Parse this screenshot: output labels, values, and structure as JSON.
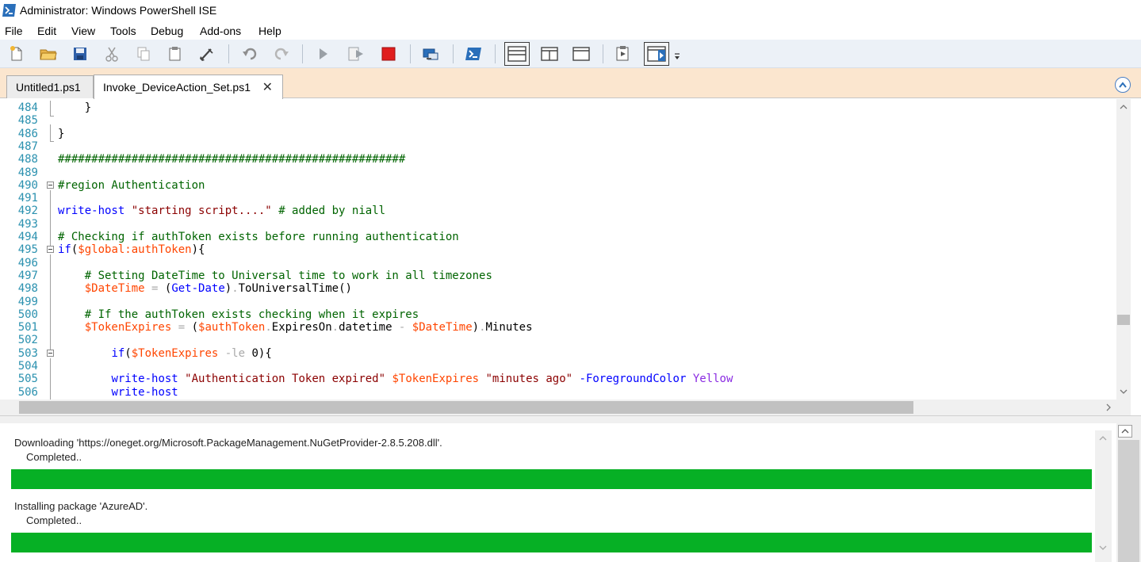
{
  "window": {
    "title": "Administrator: Windows PowerShell ISE"
  },
  "menu": {
    "items": [
      "File",
      "Edit",
      "View",
      "Tools",
      "Debug",
      "Add-ons",
      "Help"
    ]
  },
  "toolbar": {
    "buttons": [
      "new-file-icon",
      "open-folder-icon",
      "save-icon",
      "cut-icon",
      "copy-icon",
      "paste-icon",
      "clear-icon",
      "undo-icon",
      "redo-icon",
      "run-script-icon",
      "run-selection-icon",
      "stop-icon",
      "new-remote-tab-icon",
      "start-powershell-icon",
      "show-script-top-icon",
      "show-script-right-icon",
      "show-script-maximized-icon",
      "show-command-window-icon",
      "show-command-addon-icon",
      "toolbar-overflow-icon"
    ]
  },
  "tabs": [
    {
      "label": "Untitled1.ps1",
      "active": false
    },
    {
      "label": "Invoke_DeviceAction_Set.ps1",
      "active": true,
      "close_glyph": "✕"
    }
  ],
  "editor": {
    "lines": [
      {
        "n": "484",
        "tokens": [
          [
            "    }",
            "plain"
          ]
        ]
      },
      {
        "n": "485",
        "tokens": []
      },
      {
        "n": "486",
        "tokens": [
          [
            "}",
            "plain"
          ]
        ]
      },
      {
        "n": "487",
        "tokens": []
      },
      {
        "n": "488",
        "tokens": [
          [
            "####################################################",
            "comment"
          ]
        ]
      },
      {
        "n": "489",
        "tokens": []
      },
      {
        "n": "490",
        "tokens": [
          [
            "#region Authentication",
            "comment"
          ]
        ]
      },
      {
        "n": "491",
        "tokens": []
      },
      {
        "n": "492",
        "tokens": [
          [
            "write-host",
            "cmd"
          ],
          [
            " ",
            "plain"
          ],
          [
            "\"starting script....\"",
            "str"
          ],
          [
            " ",
            "plain"
          ],
          [
            "# added by niall",
            "comment"
          ]
        ]
      },
      {
        "n": "493",
        "tokens": []
      },
      {
        "n": "494",
        "tokens": [
          [
            "# Checking if authToken exists before running authentication",
            "comment"
          ]
        ]
      },
      {
        "n": "495",
        "tokens": [
          [
            "if",
            "cmd"
          ],
          [
            "(",
            "plain"
          ],
          [
            "$global:authToken",
            "var"
          ],
          [
            "){",
            "plain"
          ]
        ]
      },
      {
        "n": "496",
        "tokens": []
      },
      {
        "n": "497",
        "tokens": [
          [
            "    # Setting DateTime to Universal time to work in all timezones",
            "comment"
          ]
        ]
      },
      {
        "n": "498",
        "tokens": [
          [
            "    ",
            "plain"
          ],
          [
            "$DateTime",
            "var"
          ],
          [
            " = ",
            "op"
          ],
          [
            "(",
            "plain"
          ],
          [
            "Get-Date",
            "cmd"
          ],
          [
            ")",
            "plain"
          ],
          [
            ".",
            "op"
          ],
          [
            "ToUniversalTime",
            "member"
          ],
          [
            "()",
            "plain"
          ]
        ]
      },
      {
        "n": "499",
        "tokens": []
      },
      {
        "n": "500",
        "tokens": [
          [
            "    # If the authToken exists checking when it expires",
            "comment"
          ]
        ]
      },
      {
        "n": "501",
        "tokens": [
          [
            "    ",
            "plain"
          ],
          [
            "$TokenExpires",
            "var"
          ],
          [
            " = ",
            "op"
          ],
          [
            "(",
            "plain"
          ],
          [
            "$authToken",
            "var"
          ],
          [
            ".",
            "op"
          ],
          [
            "ExpiresOn",
            "member"
          ],
          [
            ".",
            "op"
          ],
          [
            "datetime",
            "member"
          ],
          [
            " - ",
            "op"
          ],
          [
            "$DateTime",
            "var"
          ],
          [
            ")",
            "plain"
          ],
          [
            ".",
            "op"
          ],
          [
            "Minutes",
            "member"
          ]
        ]
      },
      {
        "n": "502",
        "tokens": []
      },
      {
        "n": "503",
        "tokens": [
          [
            "        ",
            "plain"
          ],
          [
            "if",
            "cmd"
          ],
          [
            "(",
            "plain"
          ],
          [
            "$TokenExpires",
            "var"
          ],
          [
            " -le ",
            "op"
          ],
          [
            "0",
            "member"
          ],
          [
            "){",
            "plain"
          ]
        ]
      },
      {
        "n": "504",
        "tokens": []
      },
      {
        "n": "505",
        "tokens": [
          [
            "        ",
            "plain"
          ],
          [
            "write-host",
            "cmd"
          ],
          [
            " ",
            "plain"
          ],
          [
            "\"Authentication Token expired\"",
            "str"
          ],
          [
            " ",
            "plain"
          ],
          [
            "$TokenExpires",
            "var"
          ],
          [
            " ",
            "plain"
          ],
          [
            "\"minutes ago\"",
            "str"
          ],
          [
            " ",
            "plain"
          ],
          [
            "-ForegroundColor",
            "cmd"
          ],
          [
            " ",
            "plain"
          ],
          [
            "Yellow",
            "type"
          ]
        ]
      },
      {
        "n": "506",
        "tokens": [
          [
            "        ",
            "plain"
          ],
          [
            "write-host",
            "cmd"
          ]
        ]
      }
    ]
  },
  "console": {
    "entries": [
      {
        "message": "Downloading 'https://oneget.org/Microsoft.PackageManagement.NuGetProvider-2.8.5.208.dll'.",
        "status": "Completed..",
        "progress": 1.0
      },
      {
        "message": "Installing package 'AzureAD'.",
        "status": "Completed..",
        "progress": 1.0
      }
    ]
  },
  "colors": {
    "progress_fill": "#06b025",
    "tab_strip_bg": "#fbe6cf",
    "toolbar_bg": "#ecf1f7",
    "line_number": "#2b91af",
    "comment": "#006400",
    "command": "#0000ff",
    "string": "#8b0000",
    "variable": "#ff4500"
  }
}
